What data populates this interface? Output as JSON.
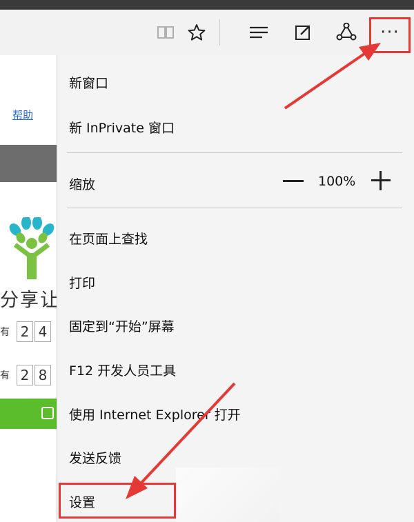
{
  "toolbar": {
    "icons": [
      "reading-view-icon",
      "favorites-star-icon",
      "hub-icon",
      "web-note-icon",
      "share-icon",
      "more-actions-icon"
    ],
    "more_label": "···"
  },
  "page": {
    "help_link": "帮助",
    "slogan": "分享让",
    "row1": {
      "label": "有",
      "digits": [
        "2",
        "4"
      ]
    },
    "row2": {
      "label": "有",
      "digits": [
        "2",
        "8"
      ]
    }
  },
  "menu": {
    "new_window": "新窗口",
    "new_inprivate": "新 InPrivate 窗口",
    "zoom_label": "缩放",
    "zoom_value": "100%",
    "find_on_page": "在页面上查找",
    "print": "打印",
    "pin_to_start": "固定到“开始”屏幕",
    "f12_tools": "F12 开发人员工具",
    "open_with_ie": "使用 Internet Explorer 打开",
    "send_feedback": "发送反馈",
    "settings": "设置"
  },
  "colors": {
    "highlight": "#e53935",
    "green_button": "#5bbd2b",
    "link": "#2a6bd1"
  }
}
